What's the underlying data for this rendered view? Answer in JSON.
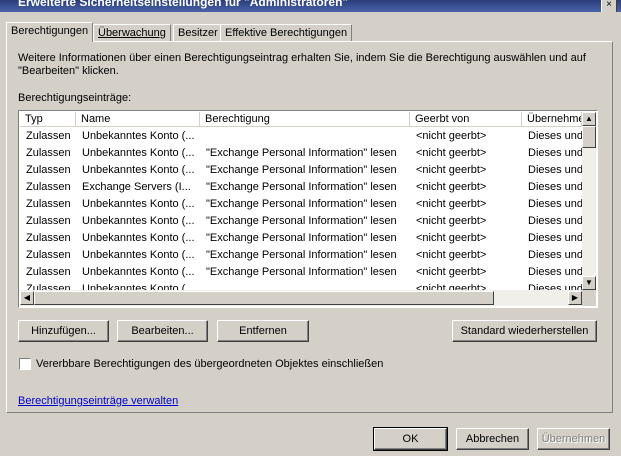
{
  "window": {
    "title": "Erweiterte Sicherheitseinstellungen für \"Administratoren\"",
    "close_glyph": "×"
  },
  "tabs": [
    {
      "label": "Berechtigungen"
    },
    {
      "label": "Überwachung"
    },
    {
      "label": "Besitzer"
    },
    {
      "label": "Effektive Berechtigungen"
    }
  ],
  "info_text": "Weitere Informationen über einen Berechtigungseintrag erhalten Sie, indem Sie die Berechtigung auswählen und auf \"Bearbeiten\" klicken.",
  "entries_label": "Berechtigungseinträge:",
  "table": {
    "columns": [
      "Typ",
      "Name",
      "Berechtigung",
      "Geerbt von",
      "Übernehme"
    ],
    "rows": [
      [
        "Zulassen",
        "Unbekanntes Konto (...",
        "",
        "<nicht geerbt>",
        "Dieses und"
      ],
      [
        "Zulassen",
        "Unbekanntes Konto (...",
        "\"Exchange Personal Information\" lesen",
        "<nicht geerbt>",
        "Dieses und"
      ],
      [
        "Zulassen",
        "Unbekanntes Konto (...",
        "\"Exchange Personal Information\" lesen",
        "<nicht geerbt>",
        "Dieses und"
      ],
      [
        "Zulassen",
        "Exchange Servers (I...",
        "\"Exchange Personal Information\" lesen",
        "<nicht geerbt>",
        "Dieses und"
      ],
      [
        "Zulassen",
        "Unbekanntes Konto (...",
        "\"Exchange Personal Information\" lesen",
        "<nicht geerbt>",
        "Dieses und"
      ],
      [
        "Zulassen",
        "Unbekanntes Konto (...",
        "\"Exchange Personal Information\" lesen",
        "<nicht geerbt>",
        "Dieses und"
      ],
      [
        "Zulassen",
        "Unbekanntes Konto (...",
        "\"Exchange Personal Information\" lesen",
        "<nicht geerbt>",
        "Dieses und"
      ],
      [
        "Zulassen",
        "Unbekanntes Konto (...",
        "\"Exchange Personal Information\" lesen",
        "<nicht geerbt>",
        "Dieses und"
      ],
      [
        "Zulassen",
        "Unbekanntes Konto (...",
        "\"Exchange Personal Information\" lesen",
        "<nicht geerbt>",
        "Dieses und"
      ],
      [
        "Zulassen",
        "Unbekanntes Konto (...",
        "",
        "<nicht geerbt>",
        "Dieses und"
      ]
    ]
  },
  "buttons": {
    "add": "Hinzufügen...",
    "edit": "Bearbeiten...",
    "remove": "Entfernen",
    "restore_default": "Standard wiederherstellen",
    "ok": "OK",
    "cancel": "Abbrechen",
    "apply": "Übernehmen"
  },
  "inherit_checkbox": {
    "label": "Vererbbare Berechtigungen des übergeordneten Objektes einschließen",
    "checked": false
  },
  "manage_link": "Berechtigungseinträge verwalten",
  "icons": {
    "scroll_up": "▲",
    "scroll_down": "▼",
    "scroll_left": "◀",
    "scroll_right": "▶"
  },
  "colors": {
    "dialog_bg": "#d4d0c8",
    "link": "#0000cc",
    "titlebar": "#2a3d7a"
  }
}
